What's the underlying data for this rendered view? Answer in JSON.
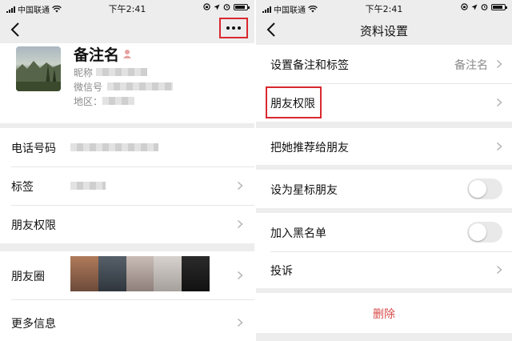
{
  "status": {
    "carrier": "中国联通",
    "time": "下午2:41"
  },
  "left": {
    "profile": {
      "name": "备注名",
      "nickname_label": "昵称",
      "wechat_id_label": "微信号",
      "region_label": "地区："
    },
    "rows": {
      "phone": "电话号码",
      "tags": "标签",
      "friend_permissions": "朋友权限",
      "moments": "朋友圈",
      "more_info": "更多信息"
    }
  },
  "right": {
    "title": "资料设置",
    "rows": {
      "set_remark": "设置备注和标签",
      "set_remark_value": "备注名",
      "friend_permissions": "朋友权限",
      "recommend": "把她推荐给朋友",
      "star_friend": "设为星标朋友",
      "blacklist": "加入黑名单",
      "complain": "投诉",
      "delete": "删除"
    },
    "toggles": {
      "star_friend": false,
      "blacklist": false
    }
  },
  "colors": {
    "accent_red": "#d9282f",
    "delete_red": "#d84a4a",
    "background": "#ededed"
  }
}
